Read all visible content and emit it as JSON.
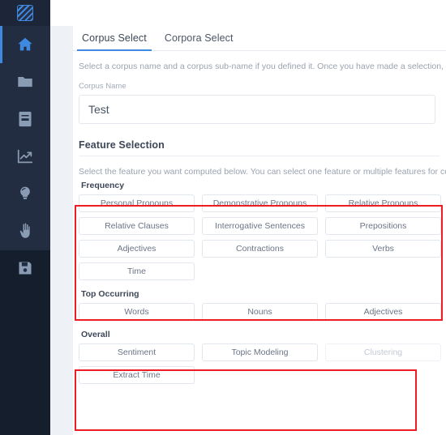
{
  "sidebar": {
    "logo": {
      "name": "app-logo",
      "icon": "striped-square-logo"
    },
    "items": [
      {
        "icon": "home-icon",
        "label": "Home",
        "active": true
      },
      {
        "icon": "folder-icon",
        "label": "Corpora",
        "active": false
      },
      {
        "icon": "book-icon",
        "label": "Documents",
        "active": false
      },
      {
        "icon": "chart-icon",
        "label": "Analytics",
        "active": false
      },
      {
        "icon": "lightbulb-icon",
        "label": "Insights",
        "active": false
      },
      {
        "icon": "hand-icon",
        "label": "Manual",
        "active": false
      },
      {
        "icon": "save-icon",
        "label": "Save",
        "active": false
      }
    ]
  },
  "tabs": [
    {
      "label": "Corpus Select",
      "active": true
    },
    {
      "label": "Corpora Select",
      "active": false
    }
  ],
  "corpus": {
    "description": "Select a corpus name and a corpus sub-name if you defined it. Once you have made a selection, click add.",
    "name_label": "Corpus Name",
    "name_value": "Test",
    "name_placeholder": "Corpus Name"
  },
  "feature_selection": {
    "title": "Feature Selection",
    "description": "Select the feature you want computed below. You can select one feature or multiple features for computation.",
    "groups": [
      {
        "title": "Frequency",
        "highlighted": true,
        "rows": [
          [
            {
              "label": "Personal Pronouns",
              "disabled": false
            },
            {
              "label": "Demonstrative Pronouns",
              "disabled": false
            },
            {
              "label": "Relative Pronouns",
              "disabled": false
            }
          ],
          [
            {
              "label": "Relative Clauses",
              "disabled": false
            },
            {
              "label": "Interrogative Sentences",
              "disabled": false
            },
            {
              "label": "Prepositions",
              "disabled": false
            }
          ],
          [
            {
              "label": "Adjectives",
              "disabled": false
            },
            {
              "label": "Contractions",
              "disabled": false
            },
            {
              "label": "Verbs",
              "disabled": false
            }
          ],
          [
            {
              "label": "Time",
              "disabled": false
            },
            {
              "label": "",
              "spacer": true
            },
            {
              "label": "",
              "spacer": true
            }
          ]
        ]
      },
      {
        "title": "Top Occurring",
        "highlighted": false,
        "rows": [
          [
            {
              "label": "Words",
              "disabled": false
            },
            {
              "label": "Nouns",
              "disabled": false
            },
            {
              "label": "Adjectives",
              "disabled": false
            }
          ]
        ]
      },
      {
        "title": "Overall",
        "highlighted": true,
        "rows": [
          [
            {
              "label": "Sentiment",
              "disabled": false
            },
            {
              "label": "Topic Modeling",
              "disabled": false
            },
            {
              "label": "Clustering",
              "disabled": true
            }
          ],
          [
            {
              "label": "Extract Time",
              "disabled": false
            },
            {
              "label": "",
              "spacer": true
            },
            {
              "label": "",
              "spacer": true
            }
          ]
        ]
      }
    ]
  },
  "colors": {
    "accent": "#3f8ae0",
    "sidebar_bg": "#151e2d",
    "sidebar_nav_bg": "#222d42",
    "highlight": "#ee1c25",
    "text": "#3d4757",
    "muted": "#9aa3b0"
  }
}
